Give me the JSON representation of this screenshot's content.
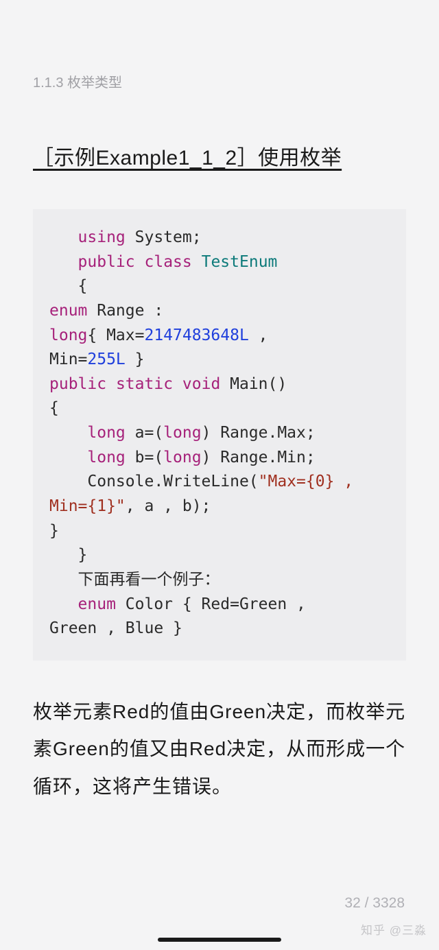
{
  "section_label": "1.1.3 枚举类型",
  "heading": "［示例Example1_1_2］使用枚举",
  "code": {
    "l1a": "using",
    "l1b": " System;",
    "l2a": "public",
    "l2b": "class",
    "l2c": "TestEnum",
    "l3": "   {",
    "l4a": "enum",
    "l4b": " Range : ",
    "l5a": "long",
    "l5b": "{ Max=",
    "l5c": "2147483648L",
    "l5d": " , ",
    "l6a": "Min=",
    "l6b": "255L",
    "l6c": " }",
    "l7a": "public",
    "l7b": "static",
    "l7c": "void",
    "l7d": " Main()",
    "l8": "{",
    "l9a": "long",
    "l9b": " a=(",
    "l9c": "long",
    "l9d": ") Range.Max;",
    "l10a": "long",
    "l10b": " b=(",
    "l10c": "long",
    "l10d": ") Range.Min;",
    "l11a": "    Console.WriteLine(",
    "l11b": "\"Max={0} , ",
    "l12a": "Min={1}\"",
    "l12b": ", a , b);",
    "l13": "}",
    "l14": "   }",
    "l15": "   下面再看一个例子：",
    "l16a": "enum",
    "l16b": " Color { Red=Green , ",
    "l17": "Green , Blue }"
  },
  "body_text": "枚举元素Red的值由Green决定，而枚举元素Green的值又由Red决定，从而形成一个循环，这将产生错误。",
  "page_current": "32",
  "page_sep": " / ",
  "page_total": "3328",
  "watermark": "知乎 @三淼"
}
